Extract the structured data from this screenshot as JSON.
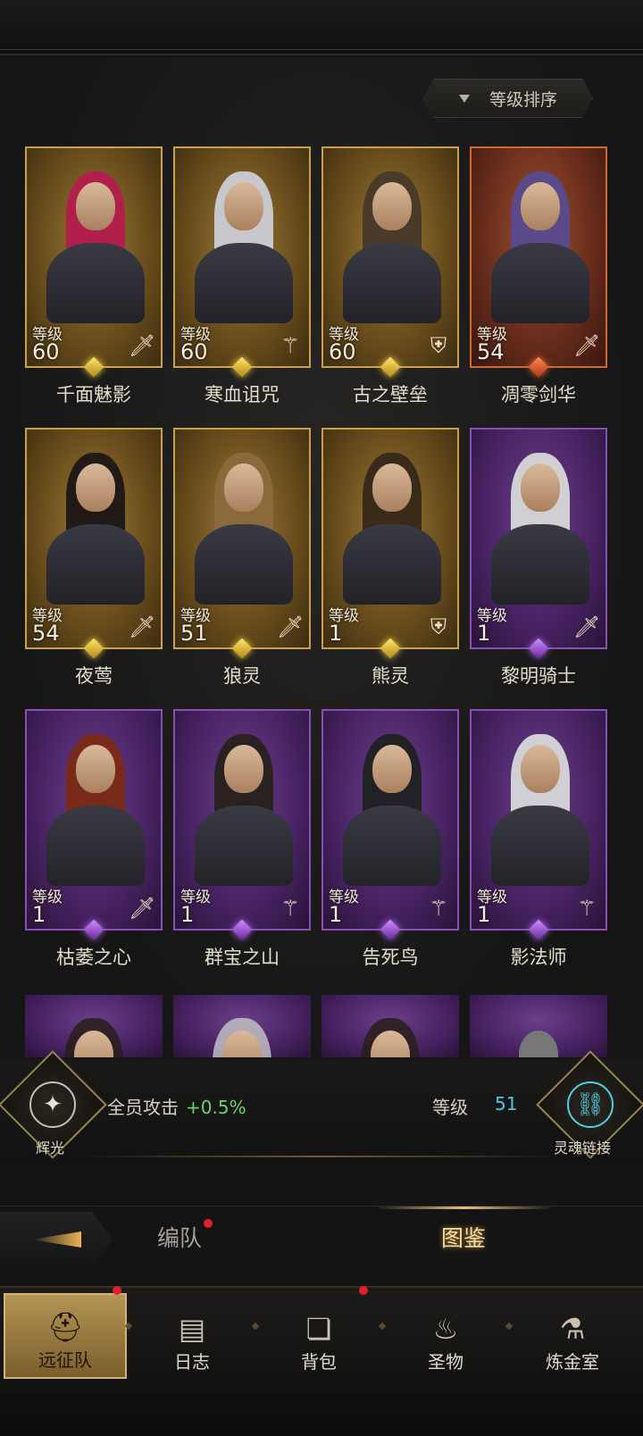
{
  "sort": {
    "label": "等级排序"
  },
  "level_word": "等级",
  "heroes": [
    {
      "name": "千面魅影",
      "level": "60",
      "role_icon": "sword-icon",
      "rarity": "gold"
    },
    {
      "name": "寒血诅咒",
      "level": "60",
      "role_icon": "staff-icon",
      "rarity": "gold"
    },
    {
      "name": "古之壁垒",
      "level": "60",
      "role_icon": "shield-icon",
      "rarity": "gold"
    },
    {
      "name": "凋零剑华",
      "level": "54",
      "role_icon": "sword-icon",
      "rarity": "orange"
    },
    {
      "name": "夜莺",
      "level": "54",
      "role_icon": "sword-icon",
      "rarity": "gold"
    },
    {
      "name": "狼灵",
      "level": "51",
      "role_icon": "sword-icon",
      "rarity": "gold"
    },
    {
      "name": "熊灵",
      "level": "1",
      "role_icon": "shield-icon",
      "rarity": "gold"
    },
    {
      "name": "黎明骑士",
      "level": "1",
      "role_icon": "sword-icon",
      "rarity": "purple"
    },
    {
      "name": "枯萎之心",
      "level": "1",
      "role_icon": "sword-icon",
      "rarity": "purple"
    },
    {
      "name": "群宝之山",
      "level": "1",
      "role_icon": "staff-icon",
      "rarity": "purple"
    },
    {
      "name": "告死鸟",
      "level": "1",
      "role_icon": "staff-icon",
      "rarity": "purple"
    },
    {
      "name": "影法师",
      "level": "1",
      "role_icon": "staff-icon",
      "rarity": "purple"
    }
  ],
  "bonus": {
    "emblem_left_label": "辉光",
    "text": "全员攻击",
    "value": "+0.5%",
    "level_label": "等级",
    "level_value": "51",
    "emblem_right_label": "灵魂链接"
  },
  "tabs": {
    "formation": "编队",
    "atlas": "图鉴"
  },
  "nav": [
    {
      "label": "远征队",
      "icon": "⛑",
      "active": true
    },
    {
      "label": "日志",
      "icon": "▤",
      "active": false
    },
    {
      "label": "背包",
      "icon": "❏",
      "active": false
    },
    {
      "label": "圣物",
      "icon": "♨",
      "active": false
    },
    {
      "label": "炼金室",
      "icon": "⚗",
      "active": false
    }
  ],
  "colors": {
    "gold": "#caa04a",
    "purple": "#8a4fb5",
    "accent_green": "#67d36b",
    "accent_cyan": "#4ec9dc"
  }
}
